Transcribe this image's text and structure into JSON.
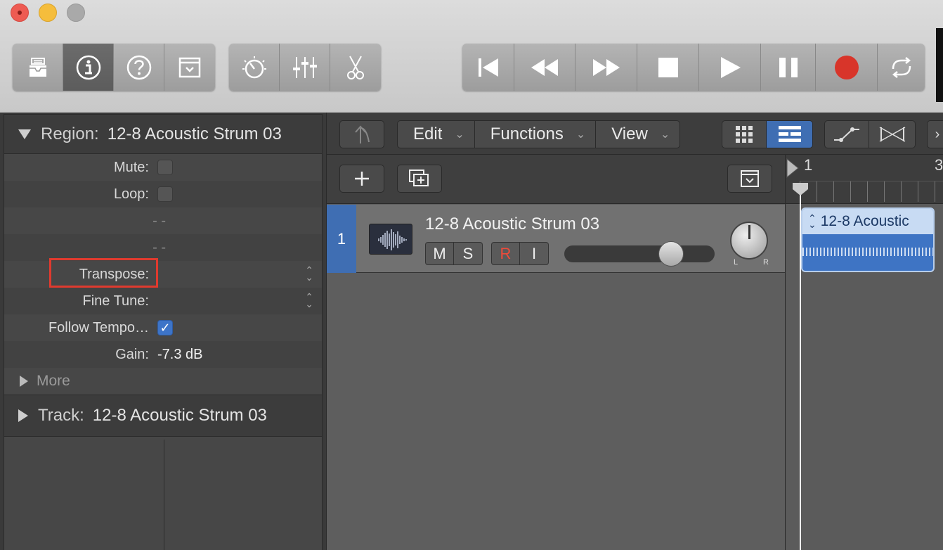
{
  "inspector": {
    "region_label": "Region:",
    "region_name": "12-8 Acoustic Strum 03",
    "rows": {
      "mute": "Mute:",
      "loop": "Loop:",
      "dash1": "- -",
      "dash2": "- -",
      "transpose": "Transpose:",
      "fine_tune": "Fine Tune:",
      "follow_tempo": "Follow Tempo…",
      "gain": "Gain:",
      "gain_value": "-7.3 dB"
    },
    "more": "More",
    "track_label": "Track:",
    "track_name": "12-8 Acoustic Strum 03"
  },
  "menus": {
    "edit": "Edit",
    "functions": "Functions",
    "view": "View"
  },
  "track": {
    "number": "1",
    "name": "12-8 Acoustic Strum 03",
    "mute": "M",
    "solo": "S",
    "record": "R",
    "input": "I",
    "pan_left": "L",
    "pan_right": "R"
  },
  "ruler": {
    "bar1": "1",
    "bar3": "3"
  },
  "region": {
    "label": "12-8 Acoustic"
  },
  "colors": {
    "accent": "#3f6eb3",
    "highlight": "#e03a2e",
    "record": "#d8352a"
  }
}
